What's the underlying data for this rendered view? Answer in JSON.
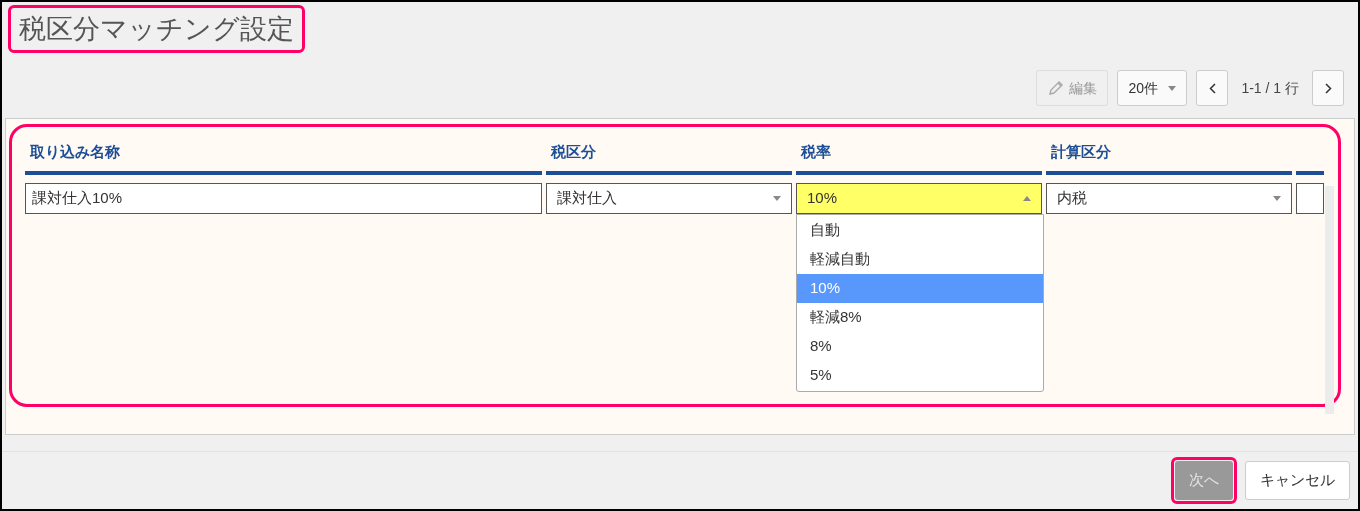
{
  "title": {
    "text": "税区分マッチング設定",
    "highlighted": true
  },
  "toolbar": {
    "edit_button": {
      "label": "編集",
      "disabled": true
    },
    "page_size": "20件",
    "pager_text": "1-1 / 1 行"
  },
  "table": {
    "highlighted": true,
    "columns": [
      "取り込み名称",
      "税区分",
      "税率",
      "計算区分"
    ],
    "rows": [
      {
        "cells": [
          {
            "kind": "text",
            "value": "課対仕入10%"
          },
          {
            "kind": "select",
            "value": "課対仕入",
            "open": false
          },
          {
            "kind": "select",
            "value": "10%",
            "open": true,
            "options": [
              {
                "label": "自動",
                "selected": false
              },
              {
                "label": "軽減自動",
                "selected": false
              },
              {
                "label": "10%",
                "selected": true
              },
              {
                "label": "軽減8%",
                "selected": false
              },
              {
                "label": "8%",
                "selected": false
              },
              {
                "label": "5%",
                "selected": false
              }
            ]
          },
          {
            "kind": "select",
            "value": "内税",
            "open": false
          }
        ]
      }
    ]
  },
  "buttons": [
    {
      "label": "次へ",
      "kind": "primary",
      "highlighted": true,
      "disabled": true
    },
    {
      "label": "キャンセル",
      "kind": "secondary",
      "highlighted": false,
      "disabled": false
    }
  ]
}
